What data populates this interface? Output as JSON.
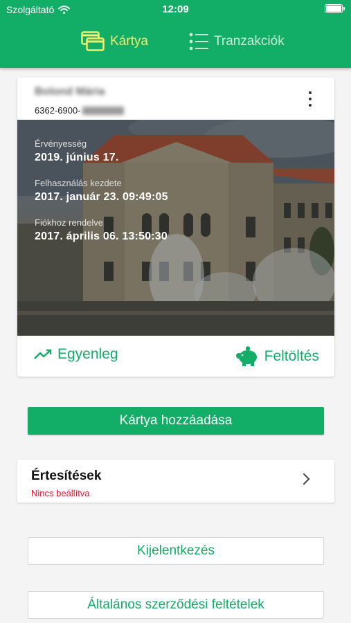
{
  "status_bar": {
    "carrier": "Szolgáltató",
    "time": "12:09"
  },
  "tabs": [
    {
      "label": "Kártya",
      "icon": "cards-icon",
      "active": true
    },
    {
      "label": "Tranzakciók",
      "icon": "list-icon",
      "active": false
    }
  ],
  "card": {
    "holder_name": "Bolond Mária",
    "number_prefix": "6362-6900-",
    "info": [
      {
        "label": "Érvényesség",
        "value": "2019. június 17."
      },
      {
        "label": "Felhasználás kezdete",
        "value": "2017. január 23. 09:49:05"
      },
      {
        "label": "Fiókhoz rendelve",
        "value": "2017. április 06. 13:50:30"
      }
    ],
    "actions": {
      "balance_label": "Egyenleg",
      "topup_label": "Feltöltés"
    }
  },
  "add_card_label": "Kártya hozzáadása",
  "notifications": {
    "title": "Értesítések",
    "status": "Nincs beállítva"
  },
  "logout_label": "Kijelentkezés",
  "terms_label": "Általános szerződési feltételek",
  "colors": {
    "accent": "#12ad66",
    "active_tab": "#f2f06a",
    "warning": "#e0182b"
  }
}
